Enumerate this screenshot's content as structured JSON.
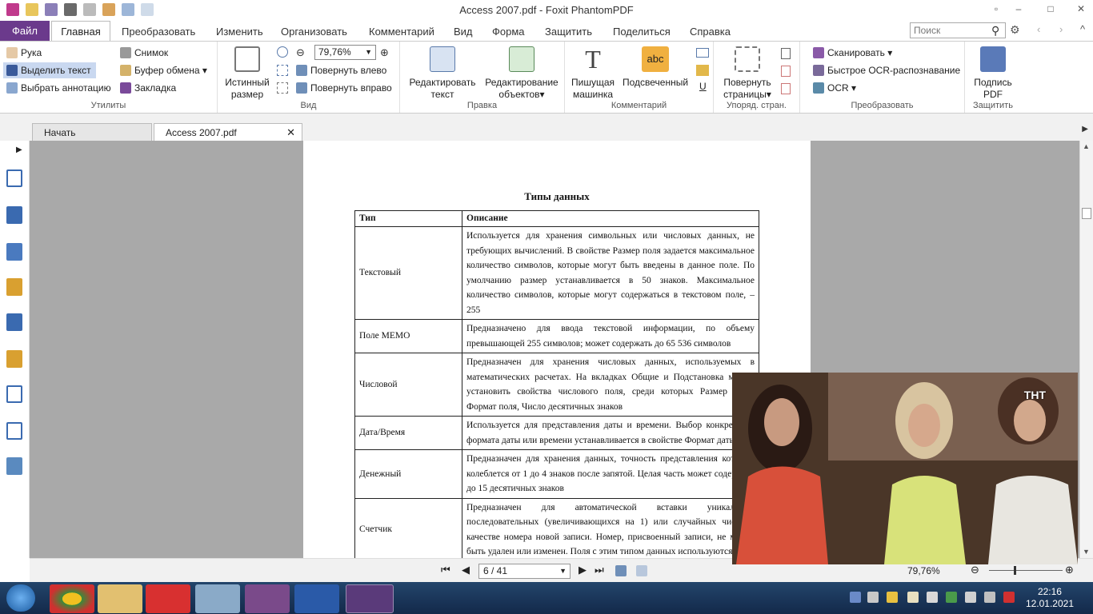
{
  "window": {
    "title": "Access 2007.pdf - Foxit PhantomPDF"
  },
  "menu": {
    "file": "Файл",
    "tabs": [
      "Главная",
      "Преобразовать",
      "Изменить",
      "Организовать",
      "Комментарий",
      "Вид",
      "Форма",
      "Защитить",
      "Поделиться",
      "Справка"
    ],
    "search_placeholder": "Поиск"
  },
  "ribbon": {
    "tools": {
      "hand": "Рука",
      "select_text": "Выделить текст",
      "select_annotation": "Выбрать аннотацию",
      "snapshot": "Снимок",
      "clipboard": "Буфер обмена",
      "bookmark": "Закладка",
      "label": "Утилиты"
    },
    "view": {
      "actual_size": "Истинный размер",
      "zoom": "79,76%",
      "rotate_left": "Повернуть влево",
      "rotate_right": "Повернуть вправо",
      "label": "Вид"
    },
    "edit": {
      "edit_text": "Редактировать текст",
      "edit_objects": "Редактирование объектов",
      "label": "Правка"
    },
    "comment": {
      "typewriter": "Пишущая машинка",
      "highlight": "Подсвеченный",
      "highlight_icon_text": "abc",
      "label": "Комментарий"
    },
    "pages": {
      "rotate_pages": "Повернуть страницы",
      "label": "Упоряд. стран."
    },
    "convert": {
      "scan": "Сканировать",
      "quick_ocr": "Быстрое OCR-распознавание",
      "ocr": "OCR",
      "label": "Преобразовать"
    },
    "protect": {
      "sign": "Подпись PDF",
      "label": "Защитить"
    }
  },
  "tabs": {
    "start": "Начать",
    "doc": "Access 2007.pdf"
  },
  "document": {
    "title": "Типы данных",
    "headers": [
      "Тип",
      "Описание"
    ],
    "rows": [
      {
        "type": "Текстовый",
        "desc": "Используется для хранения символьных или числовых данных, не требующих вычислений. В свойстве Размер поля задается максимальное количество символов, которые могут быть введены в данное поле. По умолчанию размер устанавливается в 50 знаков. Максимальное количество символов, которые могут содержаться в текстовом поле, – 255"
      },
      {
        "type": "Поле МЕМО",
        "desc": "Предназначено для ввода текстовой информации, по объему превышающей 255 символов; может содержать до 65 536 символов"
      },
      {
        "type": "Числовой",
        "desc": "Предназначен для хранения числовых данных, используемых в математических расчетах. На вкладках Общие и Подстановка можно установить свойства числового поля, среди которых Размер поля, Формат поля, Число десятичных знаков"
      },
      {
        "type": "Дата/Время",
        "desc": "Используется для представления даты и времени. Выбор конкретного формата даты или времени устанавливается в свойстве Формат даты"
      },
      {
        "type": "Денежный",
        "desc": "Предназначен для хранения данных, точность представления которых колеблется от 1 до 4 знаков после запятой. Целая часть может содержать до 15 десятичных знаков"
      },
      {
        "type": "Счетчик",
        "desc": "Предназначен для автоматической вставки уникальных последовательных (увеличивающихся на 1) или случайных чисел в качестве номера новой записи. Номер, присвоенный записи, не может быть удален или изменен. Поля с этим типом данных используются"
      }
    ]
  },
  "status": {
    "page": "6 / 41",
    "zoom": "79,76%"
  },
  "video": {
    "channel_logo": "ТНТ"
  },
  "taskbar": {
    "time": "22:16",
    "date": "12.01.2021"
  }
}
